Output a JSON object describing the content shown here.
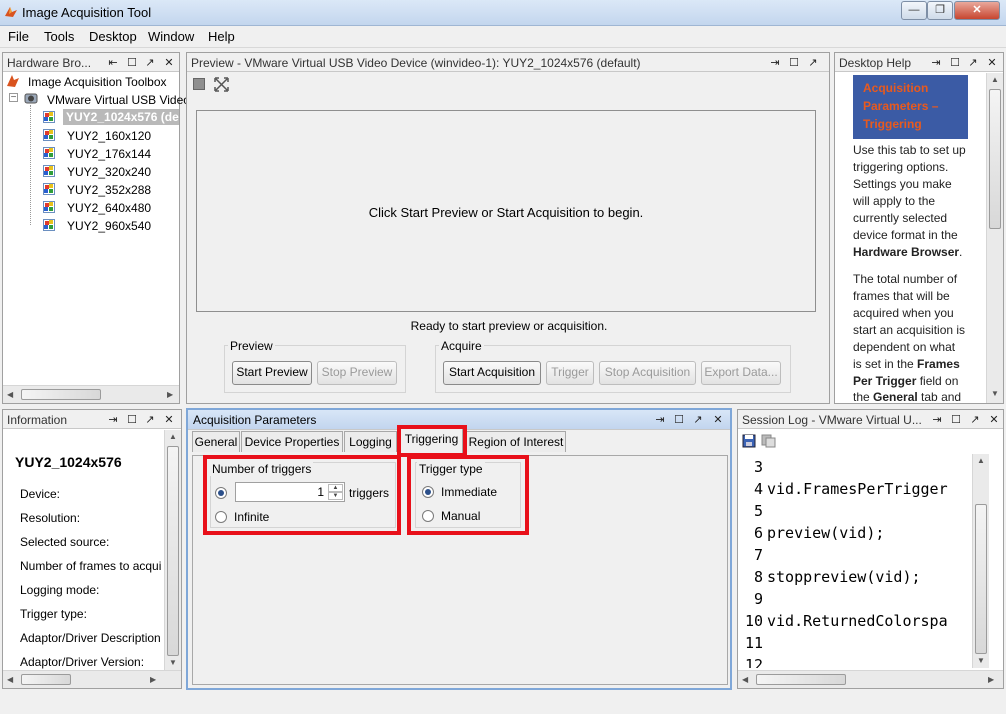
{
  "window": {
    "title": "Image Acquisition Tool",
    "minimize": "—",
    "restore": "❐",
    "close": "✕",
    "ctl_left": "▭"
  },
  "menu": [
    "File",
    "Tools",
    "Desktop",
    "Window",
    "Help"
  ],
  "panel_controls": {
    "undock": "⇤",
    "undock2": "⇥",
    "maximize": "☐",
    "float": "↗",
    "close": "✕",
    "pin": "⇥"
  },
  "hardware_browser": {
    "title": "Hardware Bro...",
    "root": "Image Acquisition Toolbox",
    "device": "VMware Virtual USB Video",
    "formats": [
      "YUY2_1024x576 (de",
      "YUY2_160x120",
      "YUY2_176x144",
      "YUY2_320x240",
      "YUY2_352x288",
      "YUY2_640x480",
      "YUY2_960x540"
    ],
    "selected_index": 0
  },
  "preview": {
    "title": "Preview - VMware Virtual USB Video Device (winvideo-1): YUY2_1024x576 (default)",
    "message": "Click Start Preview or Start Acquisition to begin.",
    "status": "Ready to start preview or acquisition.",
    "preview_group": "Preview",
    "acquire_group": "Acquire",
    "start_preview": "Start Preview",
    "stop_preview": "Stop Preview",
    "start_acquisition": "Start Acquisition",
    "trigger": "Trigger",
    "stop_acquisition": "Stop Acquisition",
    "export_data": "Export Data..."
  },
  "desktop_help": {
    "title": "Desktop Help",
    "heading_lines": [
      "Acquisition",
      "Parameters –",
      "Triggering"
    ],
    "p1_lines": [
      "Use this tab to set up",
      "triggering options.",
      "Settings you make",
      "will apply to the",
      "currently selected",
      "device format in the"
    ],
    "p1_bold": "Hardware Browser",
    "p1_end": ".",
    "p2_lines": [
      "The total number of",
      "frames that will be",
      "acquired when you",
      "start an acquisition is",
      "dependent on what",
      "is set in the"
    ],
    "p2_bold1": "Frames",
    "p2_bold2": "Per Trigger",
    "p2_after": " field on",
    "p2_the": "the ",
    "p2_bold3": "General",
    "p2_tail": " tab and"
  },
  "information": {
    "title": "Information",
    "format": "YUY2_1024x576",
    "fields": [
      "Device:",
      "Resolution:",
      "Selected source:",
      "Number of frames to acqui",
      "Logging mode:",
      "Trigger type:",
      "Adaptor/Driver Description",
      "Adaptor/Driver Version:"
    ]
  },
  "acquisition_parameters": {
    "title": "Acquisition Parameters",
    "tabs": [
      "General",
      "Device Properties",
      "Logging",
      "Triggering",
      "Region of Interest"
    ],
    "active_tab": "Triggering",
    "number_of_triggers": {
      "label": "Number of triggers",
      "value": "1",
      "unit": "triggers",
      "infinite": "Infinite",
      "selected": "value"
    },
    "trigger_type": {
      "label": "Trigger type",
      "immediate": "Immediate",
      "manual": "Manual",
      "selected": "Immediate"
    }
  },
  "session_log": {
    "title": "Session Log - VMware Virtual U...",
    "lines": [
      {
        "num": "3",
        "code": ""
      },
      {
        "num": "4",
        "code": "vid.FramesPerTrigger"
      },
      {
        "num": "5",
        "code": ""
      },
      {
        "num": "6",
        "code": "preview(vid);"
      },
      {
        "num": "7",
        "code": ""
      },
      {
        "num": "8",
        "code": "stoppreview(vid);"
      },
      {
        "num": "9",
        "code": ""
      },
      {
        "num": "10",
        "code": "vid.ReturnedColorspa"
      },
      {
        "num": "11",
        "code": ""
      },
      {
        "num": "12",
        "code": ""
      }
    ]
  },
  "colors": {
    "highlight_red": "#e8101a",
    "help_heading_bg": "#3b5ba5",
    "help_heading_text": "#e85a1e",
    "active_panel": "#c2d5ee"
  }
}
